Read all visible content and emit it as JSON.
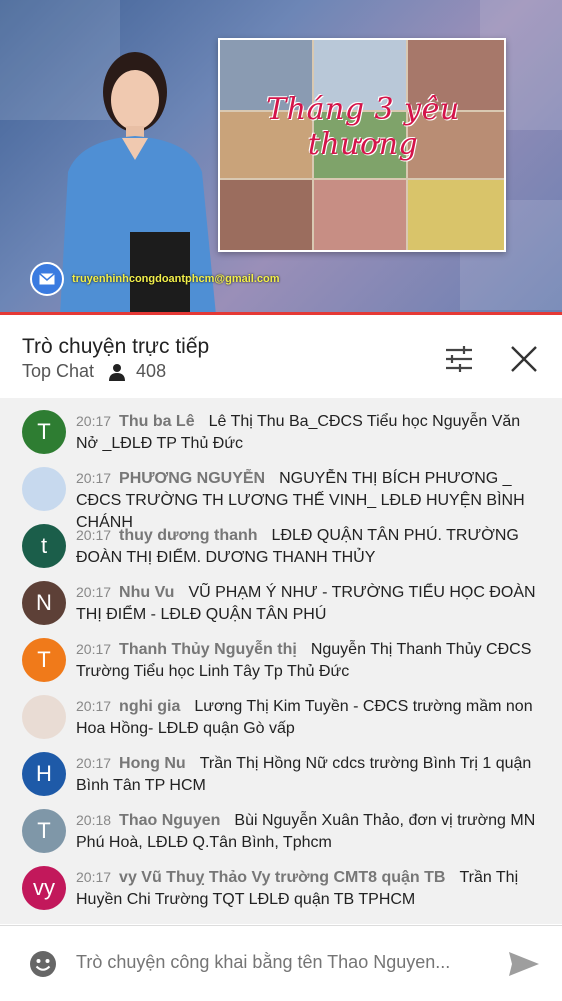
{
  "video": {
    "overlay_title": "Tháng 3 yêu thương",
    "email": "truyenhinhcongdoantphcm@gmail.com",
    "progress": 1.0
  },
  "chat": {
    "title": "Trò chuyện trực tiếp",
    "mode": "Top Chat",
    "viewer_count": "408"
  },
  "messages": [
    {
      "time": "20:17",
      "author": "Thu ba Lê",
      "text": "Lê Thị Thu Ba_CĐCS Tiểu học Nguyễn Văn Nở _LĐLĐ TP Thủ Đức",
      "avatar_letter": "T",
      "avatar_color": "#2e7d32"
    },
    {
      "time": "20:17",
      "author": "PHƯƠNG NGUYỄN",
      "text": "NGUYỄN THỊ BÍCH PHƯƠNG _ CĐCS TRƯỜNG TH LƯƠNG THẾ VINH_ LĐLĐ HUYỆN BÌNH CHÁNH",
      "avatar_letter": "",
      "avatar_color": "#c7d9ee"
    },
    {
      "time": "20:17",
      "author": "thuy dương thanh",
      "text": "LĐLĐ QUẬN TÂN PHÚ. TRƯỜNG ĐOÀN THỊ ĐIỂM. DƯƠNG THANH THỦY",
      "avatar_letter": "t",
      "avatar_color": "#1b5e4a"
    },
    {
      "time": "20:17",
      "author": "Nhu Vu",
      "text": "VŨ PHẠM Ý NHƯ - TRƯỜNG TIỂU HỌC ĐOÀN THỊ ĐIỂM - LĐLĐ QUẬN TÂN PHÚ",
      "avatar_letter": "N",
      "avatar_color": "#5d4037"
    },
    {
      "time": "20:17",
      "author": "Thanh Thủy Nguyễn thị",
      "text": "Nguyễn Thị Thanh Thủy CĐCS Trường Tiểu học Linh Tây Tp Thủ Đức",
      "avatar_letter": "T",
      "avatar_color": "#f07a1a"
    },
    {
      "time": "20:17",
      "author": "nghi gia",
      "text": "Lương Thị Kim Tuyền - CĐCS trường mầm non Hoa Hồng- LĐLĐ quận Gò vấp",
      "avatar_letter": "",
      "avatar_color": "#e9dcd4"
    },
    {
      "time": "20:17",
      "author": "Hong Nu",
      "text": "Trần Thị Hồng Nữ cdcs trường Bình Trị 1 quận Bình Tân TP HCM",
      "avatar_letter": "H",
      "avatar_color": "#1e5aa8"
    },
    {
      "time": "20:18",
      "author": "Thao Nguyen",
      "text": "Bùi Nguyễn Xuân Thảo, đơn vị trường MN Phú Hoà, LĐLĐ Q.Tân Bình, Tphcm",
      "avatar_letter": "T",
      "avatar_color": "#7f97a8"
    },
    {
      "time": "20:17",
      "author": "vy Vũ Thuỵ Thảo Vy trường CMT8 quận TB",
      "text": "Trần Thị Huyền Chi Trường TQT LĐLĐ quận TB TPHCM",
      "avatar_letter": "vy",
      "avatar_color": "#c2185b"
    }
  ],
  "input": {
    "placeholder": "Trò chuyện công khai bằng tên Thao Nguyen..."
  },
  "icons": {
    "person": "person-icon",
    "filter": "sliders-icon",
    "close": "close-icon",
    "emoji": "emoji-icon",
    "send": "send-icon"
  },
  "colors": {
    "progress": "#e53935",
    "messages_bg": "#f1f1f1"
  }
}
